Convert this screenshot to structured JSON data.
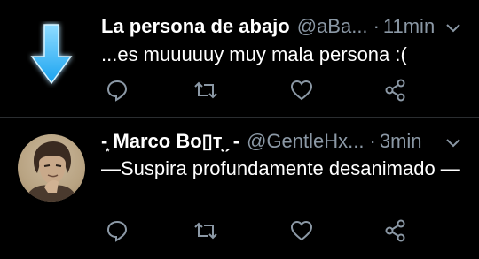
{
  "tweets": [
    {
      "display_name": "La persona de abajo",
      "handle": "@aBa...",
      "separator": "·",
      "time": "11min",
      "text": "...es muuuuuy muy mala persona :(",
      "avatar_icon": "down-arrow-icon"
    },
    {
      "display_name": "-͙ Marco Bo▯тͅ ̗ -",
      "handle": "@GentleHx...",
      "separator": "·",
      "time": "3min",
      "text": "—Suspira profundamente desanimado —",
      "avatar_icon": "user-avatar"
    }
  ],
  "colors": {
    "background": "#000000",
    "secondary_text": "#8b98a5",
    "arrow": "#1da1f2",
    "divider": "#2a2d30"
  },
  "action_icons": [
    "reply-icon",
    "retweet-icon",
    "like-icon",
    "share-icon"
  ]
}
